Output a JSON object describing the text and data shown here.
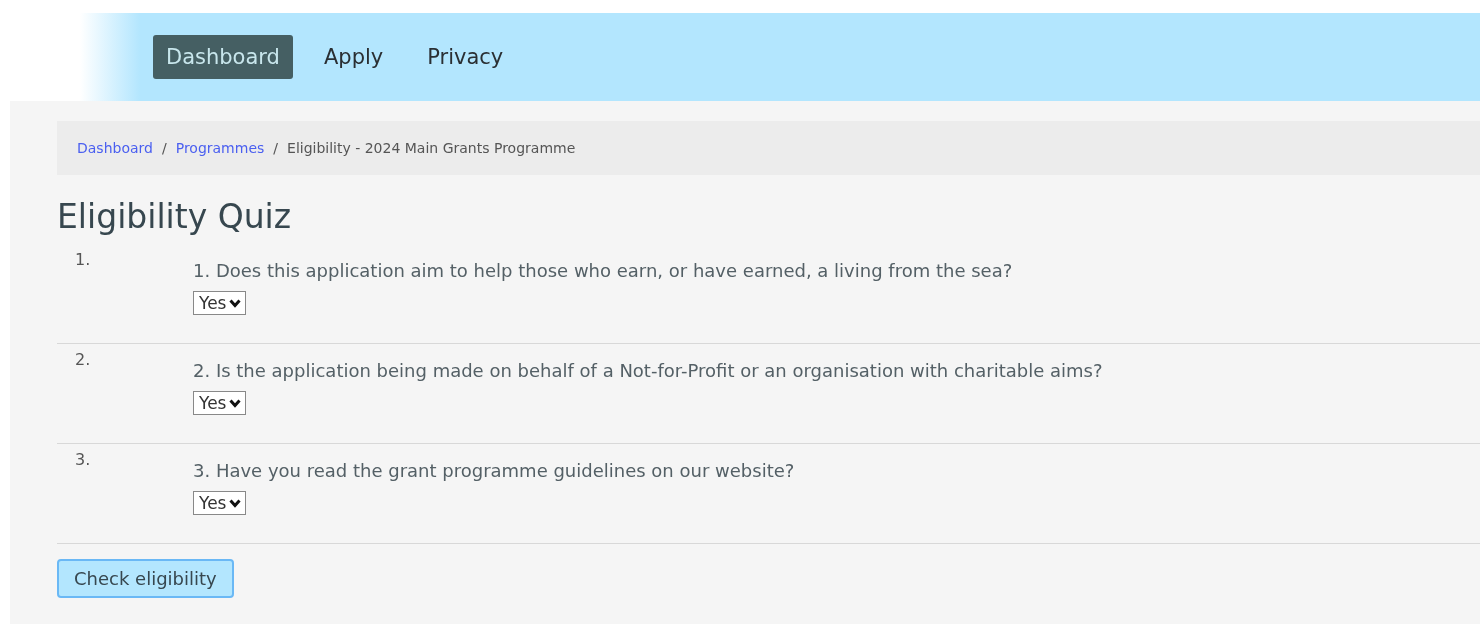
{
  "nav": [
    {
      "label": "Dashboard",
      "selected": true
    },
    {
      "label": "Apply",
      "selected": false
    },
    {
      "label": "Privacy",
      "selected": false
    }
  ],
  "breadcrumb": [
    {
      "label": "Dashboard",
      "kind": "link"
    },
    {
      "label": "Programmes",
      "kind": "link"
    },
    {
      "label": "Eligibility - 2024 Main Grants Programme",
      "kind": "current"
    }
  ],
  "breadcrumb_separator": "/",
  "title": "Eligibility Quiz",
  "questions": [
    {
      "number": "1.",
      "text": "1. Does this application aim to help those who earn, or have earned, a living from the sea?",
      "answer": "Yes"
    },
    {
      "number": "2.",
      "text": "2. Is the application being made on behalf of a Not-for-Profit or an organisation with charitable aims?",
      "answer": "Yes"
    },
    {
      "number": "3.",
      "text": "3. Have you read the grant programme guidelines on our website?",
      "answer": "Yes"
    }
  ],
  "submit": "Check eligibility"
}
